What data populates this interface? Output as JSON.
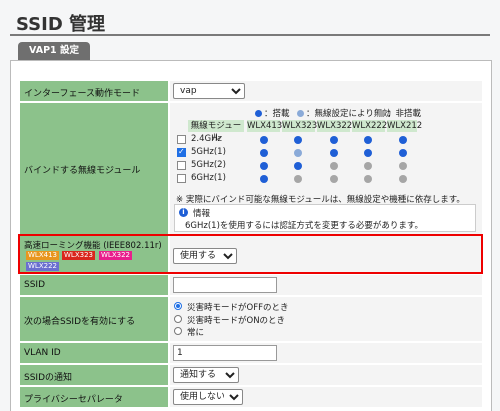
{
  "page": {
    "title": "SSID 管理",
    "tab": "VAP1 設定"
  },
  "interface_mode": {
    "label": "インターフェース動作モード",
    "value": "vap"
  },
  "modules": {
    "label": "バインドする無線モジュール",
    "legend": {
      "installed": "：搭載",
      "disabled": "：無線設定により無効",
      "not_installed": "：非搭載"
    },
    "col_header": "無線モジュール",
    "models": [
      "WLX413",
      "WLX323",
      "WLX322",
      "WLX222",
      "WLX212"
    ],
    "rows": [
      {
        "name": "2.4GHz",
        "checked": false,
        "status": [
          "installed",
          "installed",
          "installed",
          "installed",
          "installed"
        ]
      },
      {
        "name": "5GHz(1)",
        "checked": true,
        "status": [
          "installed",
          "disabled",
          "installed",
          "installed",
          "installed"
        ]
      },
      {
        "name": "5GHz(2)",
        "checked": false,
        "status": [
          "installed",
          "installed",
          "not_installed",
          "not_installed",
          "not_installed"
        ]
      },
      {
        "name": "6GHz(1)",
        "checked": false,
        "status": [
          "installed",
          "not_installed",
          "not_installed",
          "not_installed",
          "not_installed"
        ]
      }
    ],
    "note": "※ 実際にバインド可能な無線モジュールは、無線設定や機種に依存します。",
    "info_title": "情報",
    "info_text": "6GHz(1)を使用するには認証方式を変更する必要があります。"
  },
  "roaming": {
    "label": "高速ローミング機能 (IEEE802.11r)",
    "badges": [
      {
        "text": "WLX413",
        "color": "#e8961e"
      },
      {
        "text": "WLX323",
        "color": "#d9261c"
      },
      {
        "text": "WLX322",
        "color": "#e91e8c"
      },
      {
        "text": "WLX222",
        "color": "#6a6fd0"
      }
    ],
    "value": "使用する"
  },
  "ssid": {
    "label": "SSID",
    "value": ""
  },
  "enable_condition": {
    "label": "次の場合SSIDを有効にする",
    "options": [
      "災害時モードがOFFのとき",
      "災害時モードがONのとき",
      "常に"
    ],
    "selected": 0
  },
  "vlan": {
    "label": "VLAN ID",
    "value": "1"
  },
  "ssid_notify": {
    "label": "SSIDの通知",
    "value": "通知する"
  },
  "privacy": {
    "label": "プライバシーセパレータ",
    "value": "使用しない"
  },
  "colors": {
    "installed": "#1f5fd6",
    "disabled": "#8aaad8",
    "not_installed": "#a6a6a6",
    "label_bg": "#8cc28b",
    "highlight": "#e00000"
  }
}
